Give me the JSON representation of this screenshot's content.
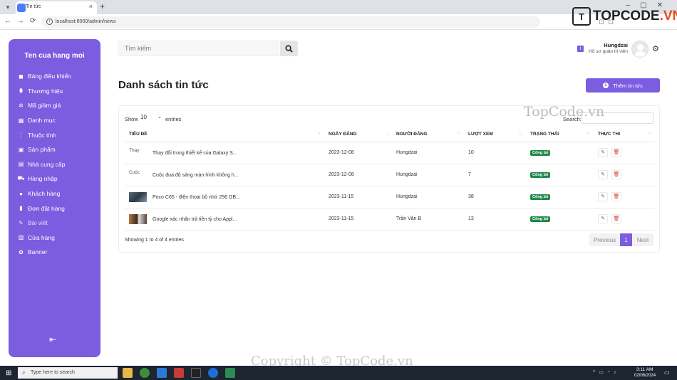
{
  "browser": {
    "tab_title": "Tin tức",
    "url": "localhost:8000/admin/news",
    "new_tab": "+",
    "tab_close": "×",
    "back": "←",
    "forward": "→",
    "reload": "⟳"
  },
  "watermark": {
    "logo_letters": "T",
    "logo_text_main": "TOPCODE",
    "logo_text_tld": ".VN",
    "mid": "TopCode.vn",
    "copyright": "Copyright © TopCode.vn"
  },
  "sidebar": {
    "store_name": "Ten cua hang moi",
    "items": [
      {
        "icon": "dashboard-icon",
        "glyph": "◼",
        "label": "Bảng điều khiển"
      },
      {
        "icon": "brand-icon",
        "glyph": "⬮",
        "label": "Thương hiệu"
      },
      {
        "icon": "discount-icon",
        "glyph": "✲",
        "label": "Mã giảm giá"
      },
      {
        "icon": "category-icon",
        "glyph": "▦",
        "label": "Danh mục"
      },
      {
        "icon": "attribute-icon",
        "glyph": "⋮",
        "label": "Thuộc tính"
      },
      {
        "icon": "product-icon",
        "glyph": "▣",
        "label": "Sản phẩm"
      },
      {
        "icon": "supplier-icon",
        "glyph": "▤",
        "label": "Nhà cung cấp"
      },
      {
        "icon": "import-icon",
        "glyph": "⛟",
        "label": "Hàng nhập"
      },
      {
        "icon": "customer-icon",
        "glyph": "●",
        "label": "Khách hàng"
      },
      {
        "icon": "order-icon",
        "glyph": "▮",
        "label": "Đơn đặt hàng"
      },
      {
        "icon": "article-icon",
        "glyph": "✎",
        "label": "Bài viết"
      },
      {
        "icon": "store-icon",
        "glyph": "▥",
        "label": "Cửa hàng"
      },
      {
        "icon": "banner-icon",
        "glyph": "✿",
        "label": "Banner"
      }
    ],
    "active_index": 10,
    "collapse_glyph": "⇤"
  },
  "search": {
    "placeholder": "Tìm kiếm"
  },
  "user": {
    "notification_badge": "i",
    "name": "Hungdzai",
    "role": "Hồ sơ quản trị viên"
  },
  "page": {
    "title": "Danh sách tin tức",
    "add_button": "Thêm tin tức"
  },
  "datatable": {
    "show_label": "Show",
    "page_size": "10",
    "entries_label": "entries",
    "search_label": "Search:",
    "columns": [
      "TIÊU ĐỀ",
      "NGÀY ĐĂNG",
      "NGƯỜI ĐĂNG",
      "LƯỢT XEM",
      "TRẠNG THÁI",
      "THỰC THI"
    ],
    "rows": [
      {
        "thumb_alt": "Thay",
        "title": "Thay đổi trong thiết kế của Galaxy S...",
        "date": "2023-12-08",
        "author": "Hungdzai",
        "views": "10",
        "status": "Công bố"
      },
      {
        "thumb_alt": "Cuộc",
        "title": "Cuộc đua độ sáng màn hình không h...",
        "date": "2023-12-08",
        "author": "Hungdzai",
        "views": "7",
        "status": "Công bố"
      },
      {
        "thumb_alt": "",
        "title": "Poco C65 - điện thoại bộ nhớ 256 GB...",
        "date": "2023-11-15",
        "author": "Hungdzai",
        "views": "38",
        "status": "Công bố"
      },
      {
        "thumb_alt": "",
        "title": "Google xác nhận trả tiền tỷ cho Appl...",
        "date": "2023-11-15",
        "author": "Trần Văn B",
        "views": "13",
        "status": "Công bố"
      }
    ],
    "info": "Showing 1 to 4 of 4 entries",
    "prev": "Previous",
    "current_page": "1",
    "next": "Next"
  },
  "taskbar": {
    "search_placeholder": "Type here to search",
    "time": "3:11 AM",
    "date": "02/06/2024"
  },
  "colors": {
    "accent": "#7c5cdf",
    "success": "#1f8a4c",
    "danger": "#d93030"
  }
}
